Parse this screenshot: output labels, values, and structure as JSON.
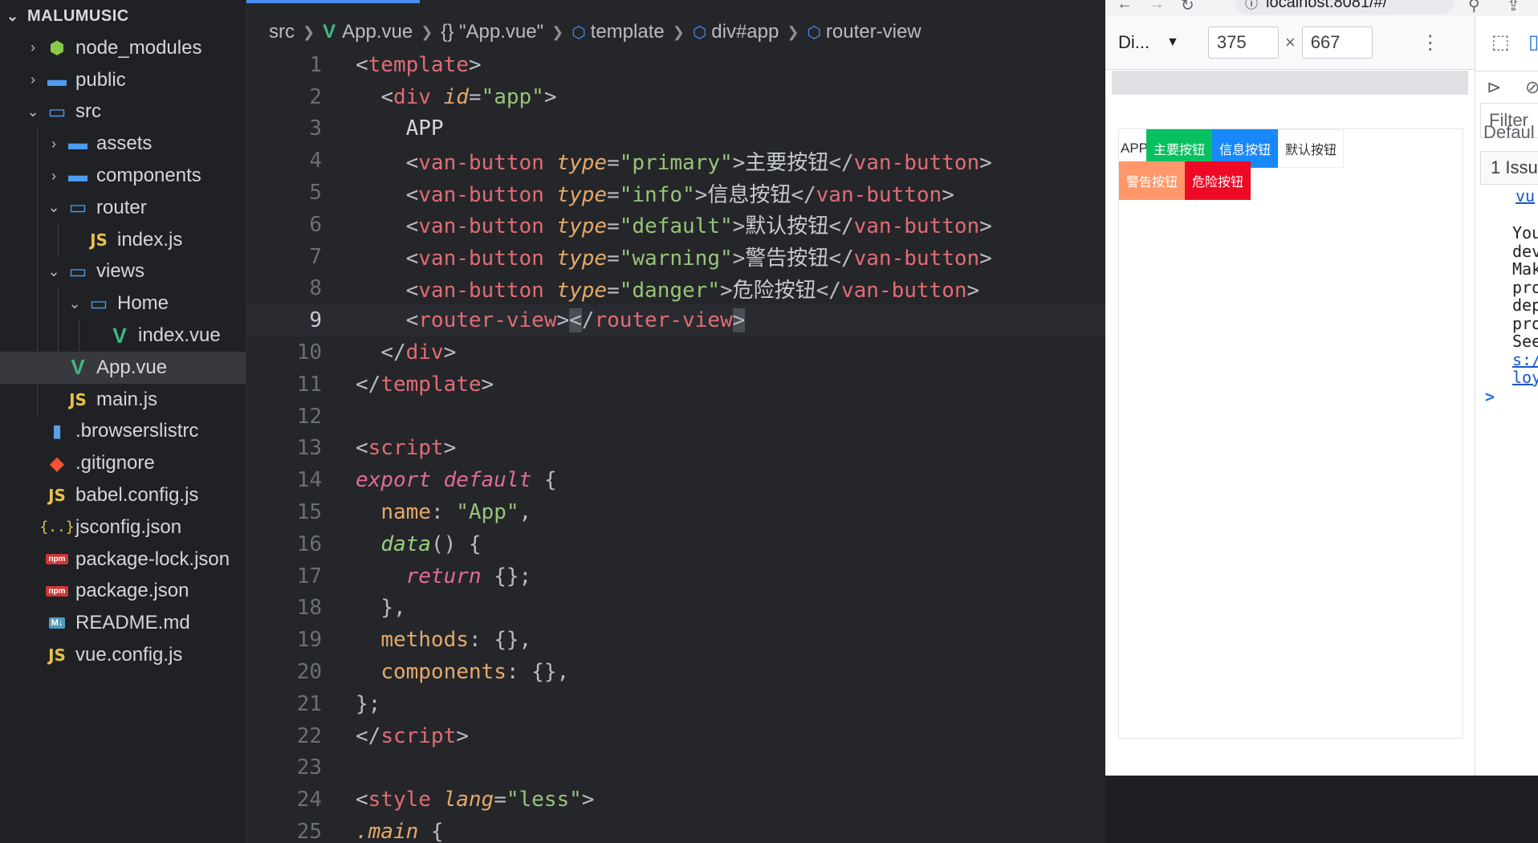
{
  "sidebar": {
    "project": "MALUMUSIC",
    "items": [
      {
        "label": "node_modules",
        "icon": "folder-node-icon",
        "chevron": "right",
        "indent": 0
      },
      {
        "label": "public",
        "icon": "folder-icon",
        "chevron": "right",
        "indent": 0
      },
      {
        "label": "src",
        "icon": "folder-open-icon",
        "chevron": "down",
        "indent": 0
      },
      {
        "label": "assets",
        "icon": "folder-icon",
        "chevron": "right",
        "indent": 1
      },
      {
        "label": "components",
        "icon": "folder-icon",
        "chevron": "right",
        "indent": 1
      },
      {
        "label": "router",
        "icon": "folder-open-icon",
        "chevron": "down",
        "indent": 1
      },
      {
        "label": "index.js",
        "icon": "js-icon",
        "chevron": "none",
        "indent": 2
      },
      {
        "label": "views",
        "icon": "folder-open-icon",
        "chevron": "down",
        "indent": 1
      },
      {
        "label": "Home",
        "icon": "folder-open-icon",
        "chevron": "down",
        "indent": 2
      },
      {
        "label": "index.vue",
        "icon": "vue-icon",
        "chevron": "none",
        "indent": 3
      },
      {
        "label": "App.vue",
        "icon": "vue-icon",
        "chevron": "none",
        "indent": 1,
        "active": true
      },
      {
        "label": "main.js",
        "icon": "js-icon",
        "chevron": "none",
        "indent": 1
      },
      {
        "label": ".browserslistrc",
        "icon": "file-icon",
        "chevron": "none",
        "indent": 0
      },
      {
        "label": ".gitignore",
        "icon": "git-icon",
        "chevron": "none",
        "indent": 0
      },
      {
        "label": "babel.config.js",
        "icon": "js-icon",
        "chevron": "none",
        "indent": 0
      },
      {
        "label": "jsconfig.json",
        "icon": "json-icon",
        "chevron": "none",
        "indent": 0
      },
      {
        "label": "package-lock.json",
        "icon": "npm-icon",
        "chevron": "none",
        "indent": 0
      },
      {
        "label": "package.json",
        "icon": "npm-icon",
        "chevron": "none",
        "indent": 0
      },
      {
        "label": "README.md",
        "icon": "markdown-icon",
        "chevron": "none",
        "indent": 0
      },
      {
        "label": "vue.config.js",
        "icon": "js-icon",
        "chevron": "none",
        "indent": 0
      }
    ]
  },
  "editor": {
    "breadcrumb": {
      "src": "src",
      "file": "App.vue",
      "block": "{} \"App.vue\"",
      "template": "template",
      "div": "div#app",
      "router": "router-view"
    },
    "current_line": 9,
    "lines": [
      {
        "n": "1",
        "tokens": [
          [
            "t-punc",
            "<"
          ],
          [
            "t-tag",
            "template"
          ],
          [
            "t-punc",
            ">"
          ]
        ]
      },
      {
        "n": "2",
        "tokens": [
          [
            "",
            "  "
          ],
          [
            "t-punc",
            "<"
          ],
          [
            "t-tag",
            "div "
          ],
          [
            "t-attr",
            "id"
          ],
          [
            "t-punc",
            "="
          ],
          [
            "t-str",
            "\"app\""
          ],
          [
            "t-punc",
            ">"
          ]
        ]
      },
      {
        "n": "3",
        "tokens": [
          [
            "",
            "    APP"
          ]
        ]
      },
      {
        "n": "4",
        "tokens": [
          [
            "",
            "    "
          ],
          [
            "t-punc",
            "<"
          ],
          [
            "t-tag",
            "van-button "
          ],
          [
            "t-attr",
            "type"
          ],
          [
            "t-punc",
            "="
          ],
          [
            "t-str",
            "\"primary\""
          ],
          [
            "t-punc",
            ">"
          ],
          [
            "t-cjk",
            "主要按钮"
          ],
          [
            "t-punc",
            "</"
          ],
          [
            "t-tag",
            "van-button"
          ],
          [
            "t-punc",
            ">"
          ]
        ]
      },
      {
        "n": "5",
        "tokens": [
          [
            "",
            "    "
          ],
          [
            "t-punc",
            "<"
          ],
          [
            "t-tag",
            "van-button "
          ],
          [
            "t-attr",
            "type"
          ],
          [
            "t-punc",
            "="
          ],
          [
            "t-str",
            "\"info\""
          ],
          [
            "t-punc",
            ">"
          ],
          [
            "t-cjk",
            "信息按钮"
          ],
          [
            "t-punc",
            "</"
          ],
          [
            "t-tag",
            "van-button"
          ],
          [
            "t-punc",
            ">"
          ]
        ]
      },
      {
        "n": "6",
        "tokens": [
          [
            "",
            "    "
          ],
          [
            "t-punc",
            "<"
          ],
          [
            "t-tag",
            "van-button "
          ],
          [
            "t-attr",
            "type"
          ],
          [
            "t-punc",
            "="
          ],
          [
            "t-str",
            "\"default\""
          ],
          [
            "t-punc",
            ">"
          ],
          [
            "t-cjk",
            "默认按钮"
          ],
          [
            "t-punc",
            "</"
          ],
          [
            "t-tag",
            "van-button"
          ],
          [
            "t-punc",
            ">"
          ]
        ]
      },
      {
        "n": "7",
        "tokens": [
          [
            "",
            "    "
          ],
          [
            "t-punc",
            "<"
          ],
          [
            "t-tag",
            "van-button "
          ],
          [
            "t-attr",
            "type"
          ],
          [
            "t-punc",
            "="
          ],
          [
            "t-str",
            "\"warning\""
          ],
          [
            "t-punc",
            ">"
          ],
          [
            "t-cjk",
            "警告按钮"
          ],
          [
            "t-punc",
            "</"
          ],
          [
            "t-tag",
            "van-button"
          ],
          [
            "t-punc",
            ">"
          ]
        ]
      },
      {
        "n": "8",
        "tokens": [
          [
            "",
            "    "
          ],
          [
            "t-punc",
            "<"
          ],
          [
            "t-tag",
            "van-button "
          ],
          [
            "t-attr",
            "type"
          ],
          [
            "t-punc",
            "="
          ],
          [
            "t-str",
            "\"danger\""
          ],
          [
            "t-punc",
            ">"
          ],
          [
            "t-cjk",
            "危险按钮"
          ],
          [
            "t-punc",
            "</"
          ],
          [
            "t-tag",
            "van-button"
          ],
          [
            "t-punc",
            ">"
          ]
        ]
      },
      {
        "n": "9",
        "tokens": [
          [
            "",
            "    "
          ],
          [
            "t-punc",
            "<"
          ],
          [
            "t-tag",
            "router-view"
          ],
          [
            "t-punc",
            ">"
          ],
          [
            "hl t-punc",
            "<"
          ],
          [
            "t-punc",
            "/"
          ],
          [
            "t-tag",
            "router-view"
          ],
          [
            "hl t-punc",
            ">"
          ]
        ]
      },
      {
        "n": "10",
        "tokens": [
          [
            "",
            "  "
          ],
          [
            "t-punc",
            "</"
          ],
          [
            "t-tag",
            "div"
          ],
          [
            "t-punc",
            ">"
          ]
        ]
      },
      {
        "n": "11",
        "tokens": [
          [
            "t-punc",
            "</"
          ],
          [
            "t-tag",
            "template"
          ],
          [
            "t-punc",
            ">"
          ]
        ]
      },
      {
        "n": "12",
        "tokens": []
      },
      {
        "n": "13",
        "tokens": [
          [
            "t-punc",
            "<"
          ],
          [
            "t-tag",
            "script"
          ],
          [
            "t-punc",
            ">"
          ]
        ]
      },
      {
        "n": "14",
        "tokens": [
          [
            "t-kw",
            "export default "
          ],
          [
            "t-punc",
            "{"
          ]
        ]
      },
      {
        "n": "15",
        "tokens": [
          [
            "",
            "  "
          ],
          [
            "t-prop",
            "name"
          ],
          [
            "t-punc",
            ": "
          ],
          [
            "t-str",
            "\"App\""
          ],
          [
            "t-punc",
            ","
          ]
        ]
      },
      {
        "n": "16",
        "tokens": [
          [
            "",
            "  "
          ],
          [
            "t-fn",
            "data"
          ],
          [
            "t-punc",
            "() {"
          ]
        ]
      },
      {
        "n": "17",
        "tokens": [
          [
            "",
            "    "
          ],
          [
            "t-kw",
            "return "
          ],
          [
            "t-punc",
            "{};"
          ]
        ]
      },
      {
        "n": "18",
        "tokens": [
          [
            "",
            "  "
          ],
          [
            "t-punc",
            "},"
          ]
        ]
      },
      {
        "n": "19",
        "tokens": [
          [
            "",
            "  "
          ],
          [
            "t-prop",
            "methods"
          ],
          [
            "t-punc",
            ": {},"
          ]
        ]
      },
      {
        "n": "20",
        "tokens": [
          [
            "",
            "  "
          ],
          [
            "t-prop",
            "components"
          ],
          [
            "t-punc",
            ": {},"
          ]
        ]
      },
      {
        "n": "21",
        "tokens": [
          [
            "t-punc",
            "};"
          ]
        ]
      },
      {
        "n": "22",
        "tokens": [
          [
            "t-punc",
            "</"
          ],
          [
            "t-tag",
            "script"
          ],
          [
            "t-punc",
            ">"
          ]
        ]
      },
      {
        "n": "23",
        "tokens": []
      },
      {
        "n": "24",
        "tokens": [
          [
            "t-punc",
            "<"
          ],
          [
            "t-tag",
            "style "
          ],
          [
            "t-attr",
            "lang"
          ],
          [
            "t-punc",
            "="
          ],
          [
            "t-str",
            "\"less\""
          ],
          [
            "t-punc",
            ">"
          ]
        ]
      },
      {
        "n": "25",
        "tokens": [
          [
            "t-cls",
            ".main "
          ],
          [
            "t-punc",
            "{"
          ]
        ]
      }
    ]
  },
  "browser": {
    "url": "localhost:8081/#/",
    "device": "Di...",
    "width": "375",
    "height": "667",
    "times": "×",
    "app_text": "APP",
    "buttons": [
      {
        "label": "主要按钮",
        "bg": "#07c160",
        "fg": "#ffffff"
      },
      {
        "label": "信息按钮",
        "bg": "#1989fa",
        "fg": "#ffffff"
      },
      {
        "label": "默认按钮",
        "bg": "#ffffff",
        "fg": "#323233"
      },
      {
        "label": "警告按钮",
        "bg": "#ff976a",
        "fg": "#ffffff"
      },
      {
        "label": "危险按钮",
        "bg": "#ee0a24",
        "fg": "#ffffff"
      }
    ]
  },
  "devtools": {
    "filter": "Filter",
    "default": "Defaul",
    "issues": "1 Issu",
    "console_link_top": "vu",
    "console_lines": [
      "You",
      "dev",
      "Mak",
      "pro",
      "dep",
      "pro",
      "See"
    ],
    "console_links": [
      "s:/",
      "loy"
    ],
    "prompt": ">"
  }
}
